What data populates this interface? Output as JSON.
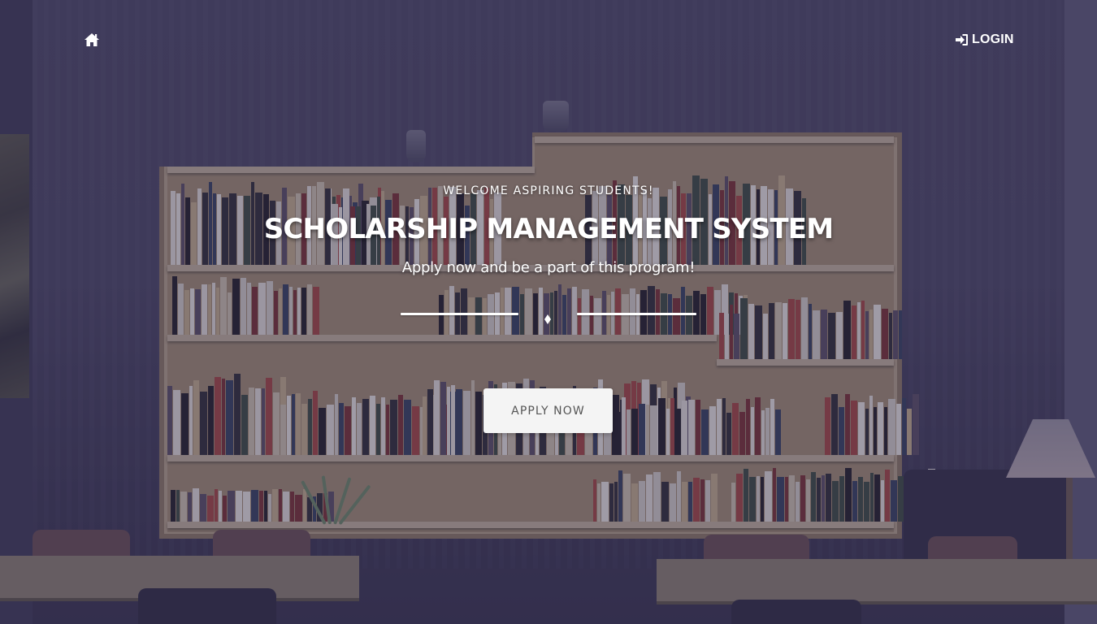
{
  "nav": {
    "home_icon": "home-icon",
    "login_icon": "sign-in-icon",
    "login_label": "LOGIN"
  },
  "hero": {
    "eyebrow": "WELCOME ASPIRING STUDENTS!",
    "title": "SCHOLARSHIP MANAGEMENT SYSTEM",
    "subtitle": "Apply now and be a part of this program!",
    "divider_icon": "diamond-icon",
    "cta_label": "APPLY NOW"
  },
  "colors": {
    "overlay": "#302c4e",
    "text": "#ffffff",
    "button_bg": "#f4f4f4",
    "button_text": "#555555"
  }
}
